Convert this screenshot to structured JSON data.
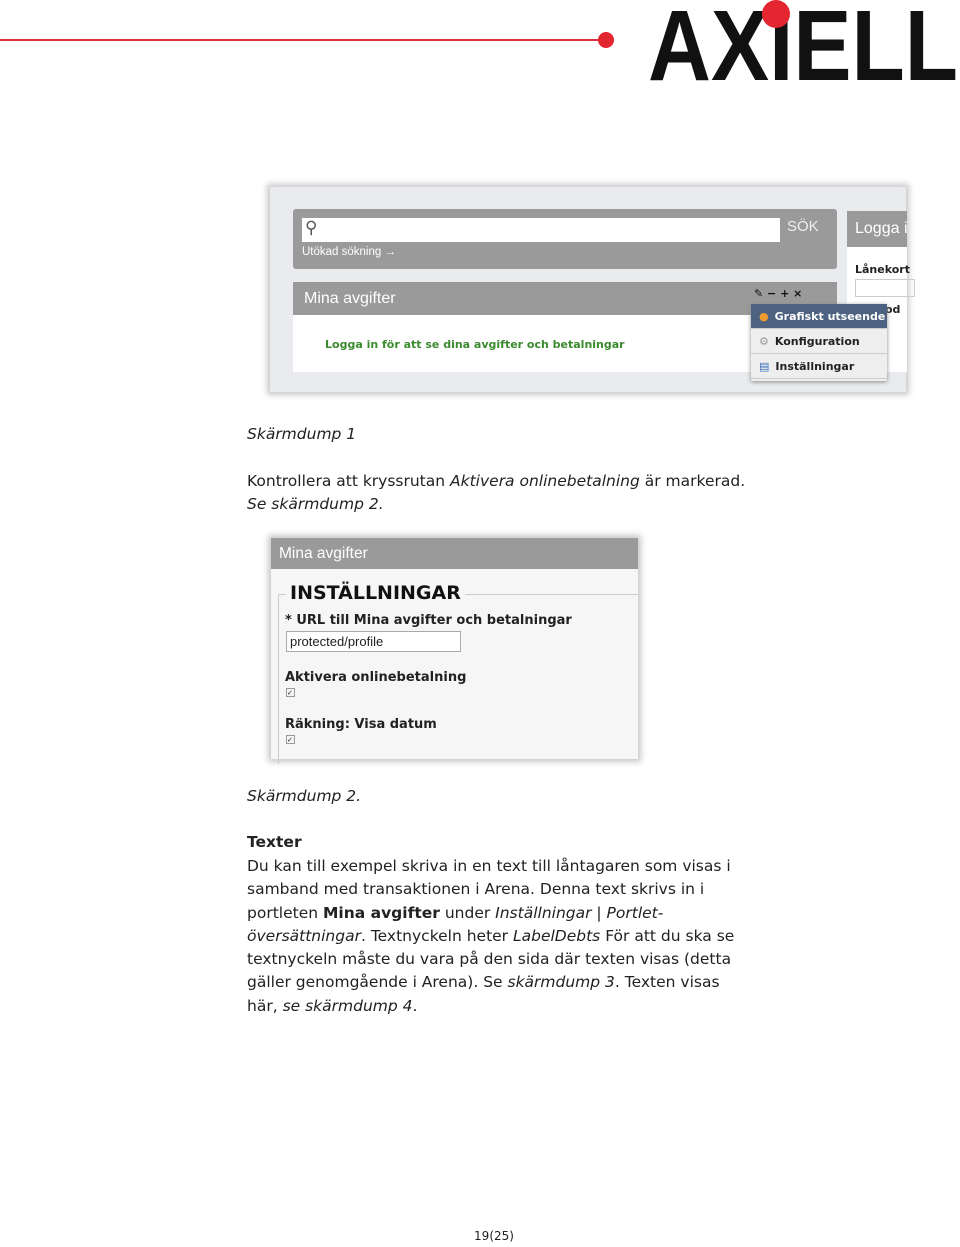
{
  "header": {
    "logo_text": "AXIELL",
    "accent": "#e3262f"
  },
  "shot1": {
    "search_button": "SÖK",
    "advanced_search": "Utökad sökning →",
    "portlet_title": "Mina avgifter",
    "portlet_tools": "✎ − + ×",
    "login_message": "Logga in för att se dina avgifter och betalningar",
    "login_panel_title": "Logga i",
    "card_label": "Lånekort",
    "pin_label": "od",
    "menu": [
      {
        "label": "Grafiskt utseende",
        "icon": "palette-icon"
      },
      {
        "label": "Konfiguration",
        "icon": "gear-icon"
      },
      {
        "label": "Inställningar",
        "icon": "settings-doc-icon"
      }
    ]
  },
  "caption1": "Skärmdump 1",
  "para1": [
    "Kontrollera att kryssrutan ",
    "Aktivera onlinebetalning",
    " är markerad. ",
    "Se skärmdump 2."
  ],
  "shot2": {
    "portlet_title": "Mina avgifter",
    "section_title": "INSTÄLLNINGAR",
    "url_label": "* URL till Mina avgifter och betalningar",
    "url_value": "protected/profile",
    "online_label": "Aktivera onlinebetalning",
    "online_checked": true,
    "date_label": "Räkning: Visa datum",
    "date_checked": true
  },
  "caption2": "Skärmdump 2.",
  "section_heading": "Texter",
  "para2": [
    "Du kan till exempel skriva in en text till låntagaren som visas i samband med transaktionen i Arena. Denna text skrivs in i portleten ",
    "Mina avgifter",
    " under ",
    "Inställningar | Portlet-översättningar",
    ". Textnyckeln heter ",
    "LabelDebts",
    " För att du ska se textnyckeln måste du vara på den sida där texten visas (detta gäller genomgående i Arena). Se ",
    "skärmdump 3",
    ". Texten visas här, ",
    "se skärmdump 4",
    "."
  ],
  "footer": {
    "page": "19(25)"
  }
}
